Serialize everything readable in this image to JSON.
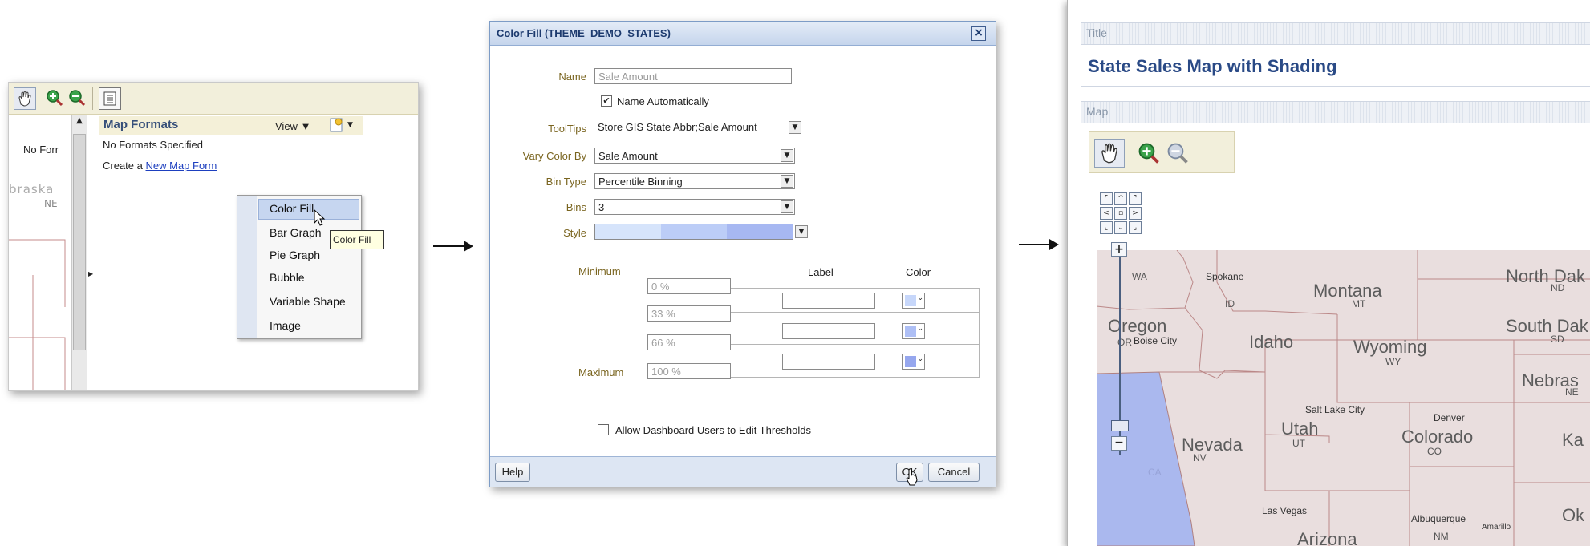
{
  "panel1": {
    "left_label": "No Forr",
    "left_state_label": "braska",
    "left_abbr": "NE",
    "formats_title": "Map Formats",
    "view_label": "View",
    "no_formats": "No Formats Specified",
    "create_prefix": "Create a",
    "create_link": "New Map Form",
    "menu_items": [
      "Color Fill",
      "Bar Graph",
      "Pie Graph",
      "Bubble",
      "Variable Shape",
      "Image"
    ],
    "tooltip": "Color Fill"
  },
  "dialog": {
    "title": "Color Fill (THEME_DEMO_STATES)",
    "name_label": "Name",
    "name_value": "Sale Amount",
    "name_auto_label": "Name Automatically",
    "name_auto_checked": "✔",
    "tooltips_label": "ToolTips",
    "tooltips_value": "Store GIS State Abbr;Sale Amount",
    "vary_label": "Vary Color By",
    "vary_value": "Sale Amount",
    "bintype_label": "Bin Type",
    "bintype_value": "Percentile Binning",
    "bins_label": "Bins",
    "bins_value": "3",
    "style_label": "Style",
    "style_colors": [
      "#d6e4fb",
      "#bccdf7",
      "#a7b8f2"
    ],
    "minimum_label": "Minimum",
    "maximum_label": "Maximum",
    "label_header": "Label",
    "color_header": "Color",
    "thresholds": [
      "0 %",
      "33 %",
      "66 %",
      "100 %"
    ],
    "bin_colors": [
      "#c7d7fa",
      "#aebff5",
      "#96a7ee"
    ],
    "allow_label": "Allow Dashboard Users to Edit Thresholds",
    "help_button": "Help",
    "ok_button": "OK",
    "cancel_button": "Cancel",
    "close_glyph": "×"
  },
  "panel3": {
    "title_section": "Title",
    "title_text": "State Sales Map with Shading",
    "map_section": "Map",
    "zoom_plus": "+",
    "zoom_minus": "−",
    "states": {
      "wa": "WA",
      "montana": "Montana",
      "mt": "MT",
      "north_dakota": "North Dak",
      "nd": "ND",
      "oregon": "Oregon",
      "or": "OR",
      "id": "ID",
      "idaho": "Idaho",
      "wyoming": "Wyoming",
      "wy": "WY",
      "south_dakota": "South Dak",
      "sd": "SD",
      "nebraska": "Nebras",
      "ne": "NE",
      "utah": "Utah",
      "ut": "UT",
      "colorado": "Colorado",
      "co": "CO",
      "nevada": "Nevada",
      "nv": "NV",
      "kansas": "Ka",
      "arizona": "Arizona",
      "nm": "NM",
      "ok": "Ok",
      "ca": "CA"
    },
    "cities": {
      "spokane": "Spokane",
      "boise": "Boise City",
      "slc": "Salt Lake City",
      "denver": "Denver",
      "las_vegas": "Las Vegas",
      "albuquerque": "Albuquerque",
      "amarillo": "Amarillo"
    },
    "california_fill": "#aab8ee"
  }
}
